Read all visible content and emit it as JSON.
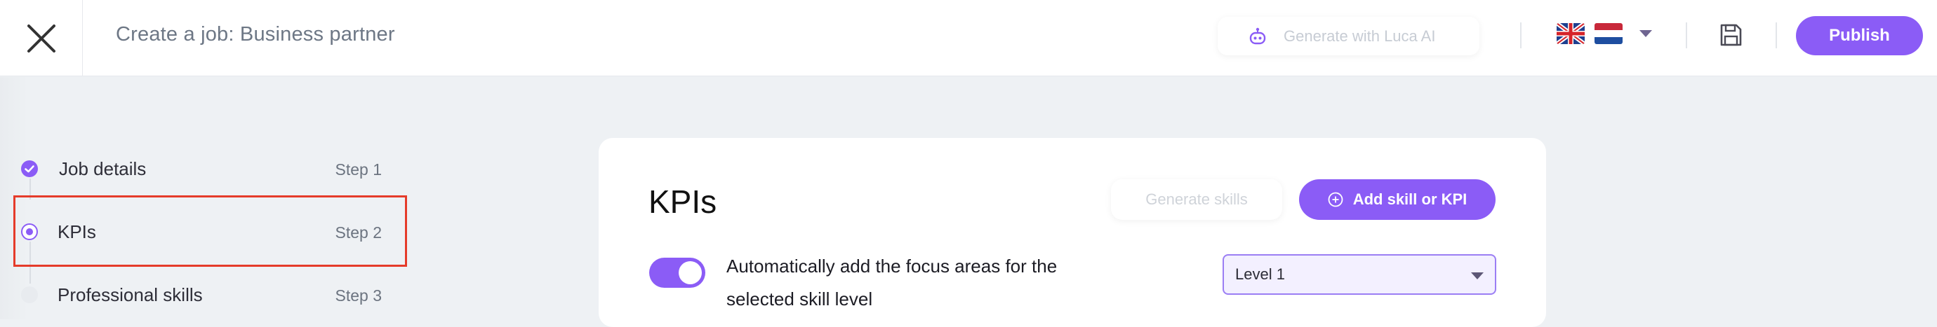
{
  "header": {
    "title": "Create a job: Business partner",
    "generate_ai_label": "Generate with Luca AI",
    "publish_label": "Publish",
    "languages": [
      "flag-uk-icon",
      "flag-nl-icon"
    ]
  },
  "sidebar": {
    "steps": [
      {
        "label": "Job details",
        "step": "Step 1",
        "state": "done"
      },
      {
        "label": "KPIs",
        "step": "Step 2",
        "state": "active"
      },
      {
        "label": "Professional skills",
        "step": "Step 3",
        "state": "todo"
      }
    ]
  },
  "main": {
    "card_title": "KPIs",
    "generate_skills_label": "Generate skills",
    "add_skill_label": "Add skill or KPI",
    "toggle_on": true,
    "toggle_label_line1": "Automatically add the focus areas for the",
    "toggle_label_line2": "selected skill level",
    "level_select": "Level 1"
  },
  "colors": {
    "accent": "#8b5cf6",
    "highlight": "#e53b2a",
    "muted_text": "#6d7785"
  }
}
